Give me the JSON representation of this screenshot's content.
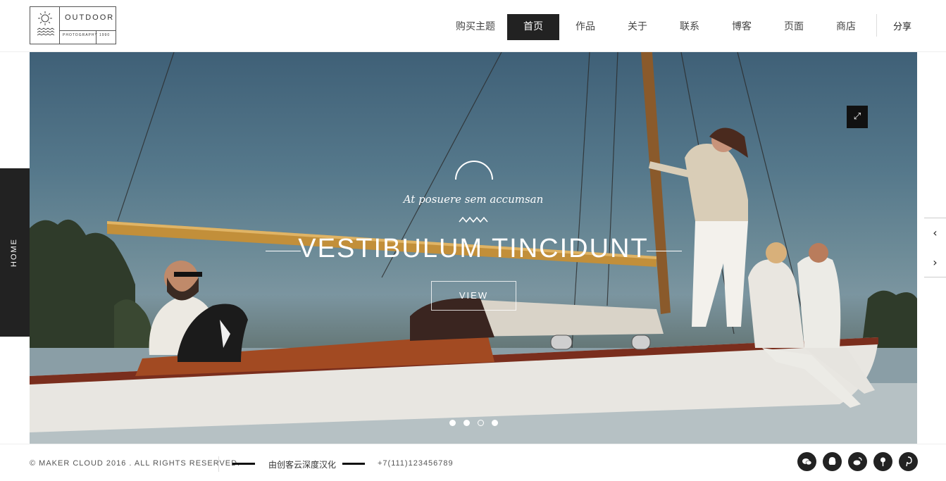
{
  "logo": {
    "brand": "OUTDOOR",
    "sub": "PHOTOGRAPHY",
    "year": "1990"
  },
  "nav": {
    "items": [
      {
        "label": "购买主题"
      },
      {
        "label": "首页"
      },
      {
        "label": "作品"
      },
      {
        "label": "关于"
      },
      {
        "label": "联系"
      },
      {
        "label": "博客"
      },
      {
        "label": "页面"
      },
      {
        "label": "商店"
      }
    ],
    "active": "首页",
    "share": "分享"
  },
  "side": {
    "home_label": "HOME"
  },
  "hero": {
    "subtitle": "At posuere sem accumsan",
    "title": "VESTIBULUM TINCIDUNT",
    "button": "VIEW",
    "expand_icon": "expand-icon",
    "dots": [
      {
        "state": "filled"
      },
      {
        "state": "filled"
      },
      {
        "state": "hollow"
      },
      {
        "state": "filled"
      }
    ]
  },
  "arrows": {
    "prev": "‹",
    "next": "›"
  },
  "footer": {
    "copyright": "© MAKER CLOUD 2016 . ALL RIGHTS RESERVED.",
    "credit": "由创客云深度汉化",
    "phone": "+7(111)123456789",
    "social": [
      "wechat-icon",
      "qq-icon",
      "weibo-icon",
      "tencent-icon",
      "pinterest-icon"
    ]
  }
}
